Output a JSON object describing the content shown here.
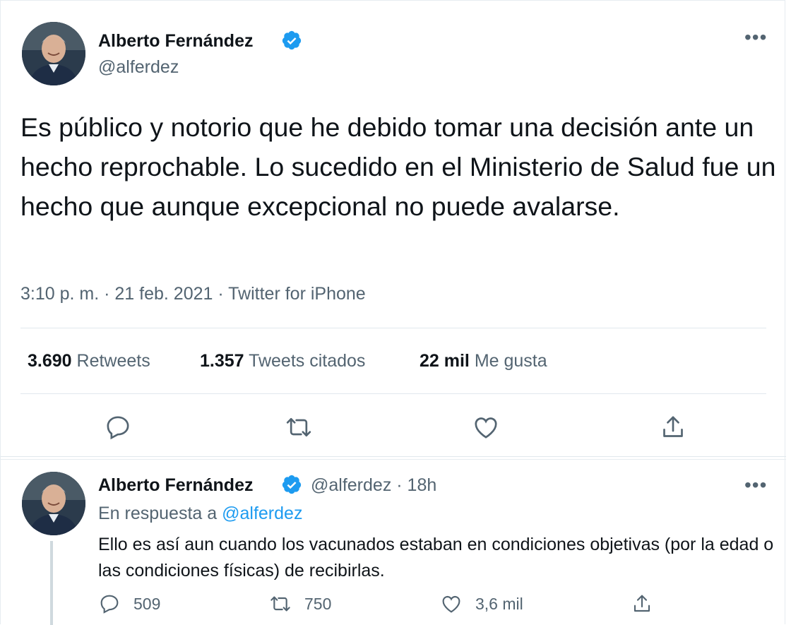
{
  "main_tweet": {
    "author_name": "Alberto Fernández",
    "author_handle": "@alferdez",
    "more_icon": "•••",
    "text": "Es público y notorio que he debido tomar una decisión ante un hecho reprochable. Lo sucedido en el Ministerio de Salud fue un hecho que aunque excepcional no puede avalarse.",
    "timestamp": "3:10 p. m. · 21 feb. 2021 · Twitter for iPhone",
    "stats": {
      "retweets_count": "3.690",
      "retweets_label": "Retweets",
      "quotes_count": "1.357",
      "quotes_label": "Tweets citados",
      "likes_count": "22 mil",
      "likes_label": "Me gusta"
    },
    "actions": [
      "reply-icon",
      "retweet-icon",
      "like-icon",
      "share-icon"
    ]
  },
  "reply_tweet": {
    "author_name": "Alberto Fernández",
    "handle_time": "@alferdez · 18h",
    "more_icon": "•••",
    "reply_prefix": "En respuesta a ",
    "reply_handle": "@alferdez",
    "text": "Ello es así aun cuando los vacunados estaban en condiciones objetivas (por la edad o las condiciones físicas) de recibirlas.",
    "replies": "509",
    "retweets": "750",
    "likes": "3,6 mil"
  },
  "colors": {
    "text_primary": "#0f1419",
    "text_secondary": "#536471",
    "link": "#1d9bf0",
    "verified": "#1d9bf0",
    "divider": "#e1e8ed"
  }
}
